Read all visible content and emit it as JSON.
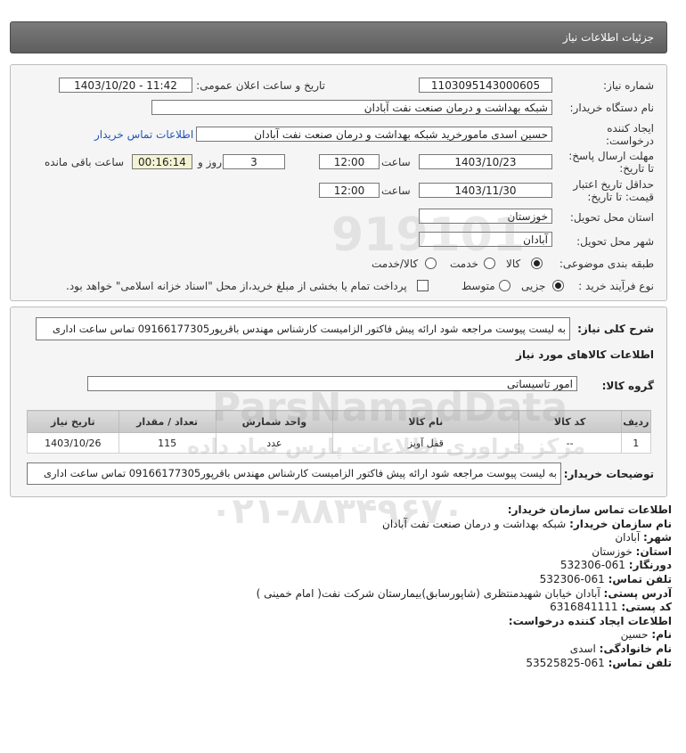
{
  "header": {
    "title": "جزئیات اطلاعات نیاز"
  },
  "form": {
    "need_number_label": "شماره نیاز:",
    "need_number": "1103095143000605",
    "announce_label": "تاریخ و ساعت اعلان عمومی:",
    "announce_value": "1403/10/20 - 11:42",
    "buyer_org_label": "نام دستگاه خریدار:",
    "buyer_org": "شبکه بهداشت و درمان صنعت نفت آبادان",
    "creator_label_1": "ایجاد کننده",
    "creator_label_2": "درخواست:",
    "creator": "حسین اسدی مامورخرید شبکه بهداشت و درمان صنعت نفت آبادان",
    "buyer_contact_link": "اطلاعات تماس خریدار",
    "deadline_label_1": "مهلت ارسال پاسخ:",
    "deadline_label_2": "تا تاریخ:",
    "deadline_date": "1403/10/23",
    "time_label": "ساعت",
    "deadline_time": "12:00",
    "days": "3",
    "days_label": "روز و",
    "remaining": "00:16:14",
    "remaining_label": "ساعت باقی مانده",
    "validity_label_1": "حداقل تاریخ اعتبار",
    "validity_label_2": "قیمت: تا تاریخ:",
    "validity_date": "1403/11/30",
    "validity_time": "12:00",
    "province_label": "استان محل تحویل:",
    "province": "خوزستان",
    "city_label": "شهر محل تحویل:",
    "city": "آبادان",
    "category_label": "طبقه بندی موضوعی:",
    "category_options": [
      "کالا",
      "خدمت",
      "کالا/خدمت"
    ],
    "category_selected": "کالا",
    "process_label": "نوع فرآیند خرید :",
    "process_options": [
      "جزیی",
      "متوسط"
    ],
    "process_selected": "جزیی",
    "payment_note": "پرداخت تمام یا بخشی از مبلغ خرید،از محل \"اسناد خزانه اسلامی\" خواهد بود."
  },
  "details": {
    "desc_label": "شرح کلی نیاز:",
    "desc": "به لیست پیوست مراجعه شود ارائه پیش فاکتور الزامیست کارشناس مهندس باقرپور09166177305 تماس ساعت اداری",
    "goods_info_title": "اطلاعات کالاهای مورد نیاز",
    "goods_group_label": "گروه کالا:",
    "goods_group": "امور تاسیساتی",
    "table": {
      "headers": [
        "ردیف",
        "کد کالا",
        "نام کالا",
        "واحد شمارش",
        "تعداد / مقدار",
        "تاریخ نیاز"
      ],
      "rows": [
        [
          "1",
          "--",
          "قفل آویز",
          "عدد",
          "115",
          "1403/10/26"
        ]
      ]
    },
    "buyer_notes_label": "توضیحات خریدار:",
    "buyer_notes": "به لیست پیوست مراجعه شود ارائه پیش فاکتور الزامیست کارشناس مهندس باقرپور09166177305 تماس ساعت اداری"
  },
  "contact": {
    "title": "اطلاعات تماس سازمان خریدار:",
    "lines": [
      {
        "label": "نام سازمان خریدار:",
        "value": "شبکه بهداشت و درمان صنعت نفت آبادان"
      },
      {
        "label": "شهر:",
        "value": "آبادان"
      },
      {
        "label": "استان:",
        "value": "خوزستان"
      },
      {
        "label": "دورنگار:",
        "value": "061-532306"
      },
      {
        "label": "تلفن تماس:",
        "value": "061-532306"
      },
      {
        "label": "آدرس پستی:",
        "value": "آبادان خیابان شهیدمنتظری (شاپورسابق)بیمارستان شرکت نفت( امام خمینی )"
      },
      {
        "label": "کد پستی:",
        "value": "6316841111"
      }
    ],
    "creator_title": "اطلاعات ایجاد کننده درخواست:",
    "creator_lines": [
      {
        "label": "نام:",
        "value": "حسین"
      },
      {
        "label": "نام خانوادگی:",
        "value": "اسدی"
      },
      {
        "label": "تلفن تماس:",
        "value": "061-53525825"
      }
    ]
  },
  "watermark": {
    "brand": "ParsNamadData",
    "tagline": "مرکز فراوری اطلاعات پارس نماد داده",
    "phone": "۰۲۱-۸۸۳۴۹۶۷۰"
  }
}
